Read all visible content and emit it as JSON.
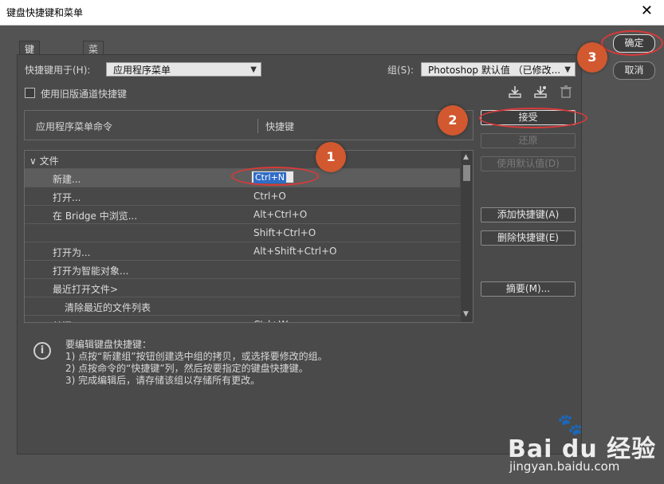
{
  "window": {
    "title": "键盘快捷键和菜单",
    "close_glyph": "✕"
  },
  "tabs": [
    {
      "label": "键盘快捷键"
    },
    {
      "label": "菜单"
    }
  ],
  "shortcuts_for": {
    "label": "快捷键用于(H):",
    "value": "应用程序菜单"
  },
  "group": {
    "label": "组(S):",
    "value": "Photoshop 默认值 （已修改..."
  },
  "legacy_checkbox": {
    "label": "使用旧版通道快捷键",
    "checked": false
  },
  "icons": [
    "save-set-icon",
    "save-as-icon",
    "delete-icon"
  ],
  "table": {
    "col_command": "应用程序菜单命令",
    "col_shortcut": "快捷键",
    "rows": [
      {
        "cmd": "∨ 文件",
        "key": "",
        "indent": 0
      },
      {
        "cmd": "新建...",
        "key": "Ctrl+N",
        "indent": 1,
        "selected": true,
        "editing": true
      },
      {
        "cmd": "打开...",
        "key": "Ctrl+O",
        "indent": 1
      },
      {
        "cmd": "在 Bridge 中浏览...",
        "key": "Alt+Ctrl+O",
        "indent": 1
      },
      {
        "cmd": "",
        "key": "Shift+Ctrl+O",
        "indent": 1
      },
      {
        "cmd": "打开为...",
        "key": "Alt+Shift+Ctrl+O",
        "indent": 1
      },
      {
        "cmd": "打开为智能对象...",
        "key": "",
        "indent": 1
      },
      {
        "cmd": "最近打开文件>",
        "key": "",
        "indent": 1
      },
      {
        "cmd": "清除最近的文件列表",
        "key": "",
        "indent": 2
      },
      {
        "cmd": "关闭",
        "key": "Ctrl+W",
        "indent": 1
      }
    ]
  },
  "buttons": {
    "ok": "确定",
    "cancel": "取消",
    "accept": "接受",
    "undo": "还原",
    "use_default": "使用默认值(D)",
    "add_shortcut": "添加快捷键(A)",
    "delete_shortcut": "删除快捷键(E)",
    "summarize": "摘要(M)..."
  },
  "info": {
    "lines": [
      "要编辑键盘快捷键：",
      "1) 点按“新建组”按钮创建选中组的拷贝，或选择要修改的组。",
      "2) 点按命令的“快捷键”列，然后按要指定的键盘快捷键。",
      "3) 完成编辑后，请存储该组以存储所有更改。"
    ]
  },
  "annotations": {
    "one": "1",
    "two": "2",
    "three": "3",
    "color": "#d83a3a"
  },
  "watermark": {
    "brand": "Bai du 经验",
    "url": "jingyan.baidu.com"
  }
}
